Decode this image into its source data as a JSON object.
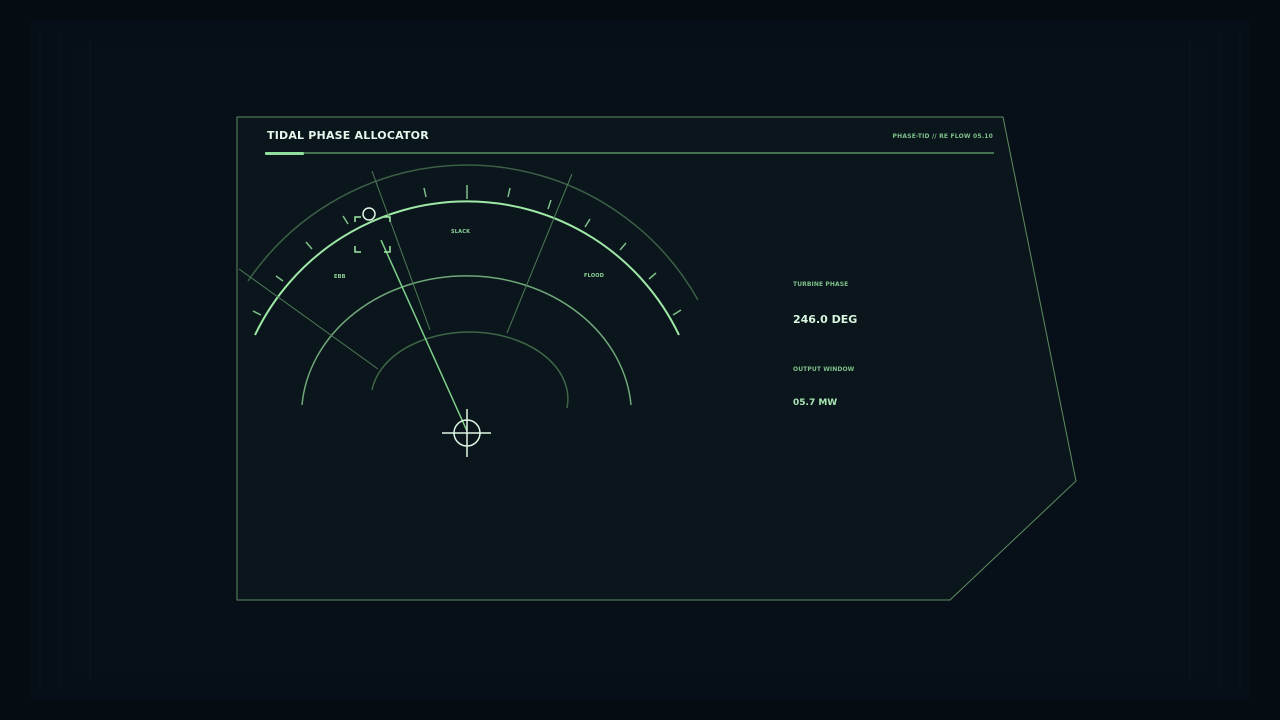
{
  "header": {
    "title": "TIDAL PHASE ALLOCATOR",
    "code": "PHASE-TID // RE FLOW 05.10"
  },
  "dial": {
    "labels": {
      "ebb": "EBB",
      "slack": "SLACK",
      "flood": "FLOOD"
    }
  },
  "readouts": {
    "turbine_phase": {
      "label": "TURBINE PHASE",
      "value": "246.0 DEG"
    },
    "output_window": {
      "label": "OUTPUT WINDOW",
      "value": "05.7 MW"
    }
  },
  "colors": {
    "accent": "#9fe8a8",
    "accent_dim": "#6fa879",
    "panel_bg": "#0a161b",
    "page_bg": "#050d12"
  },
  "icons": {
    "target": "crosshair-icon",
    "selector": "bracket-marker-icon"
  }
}
